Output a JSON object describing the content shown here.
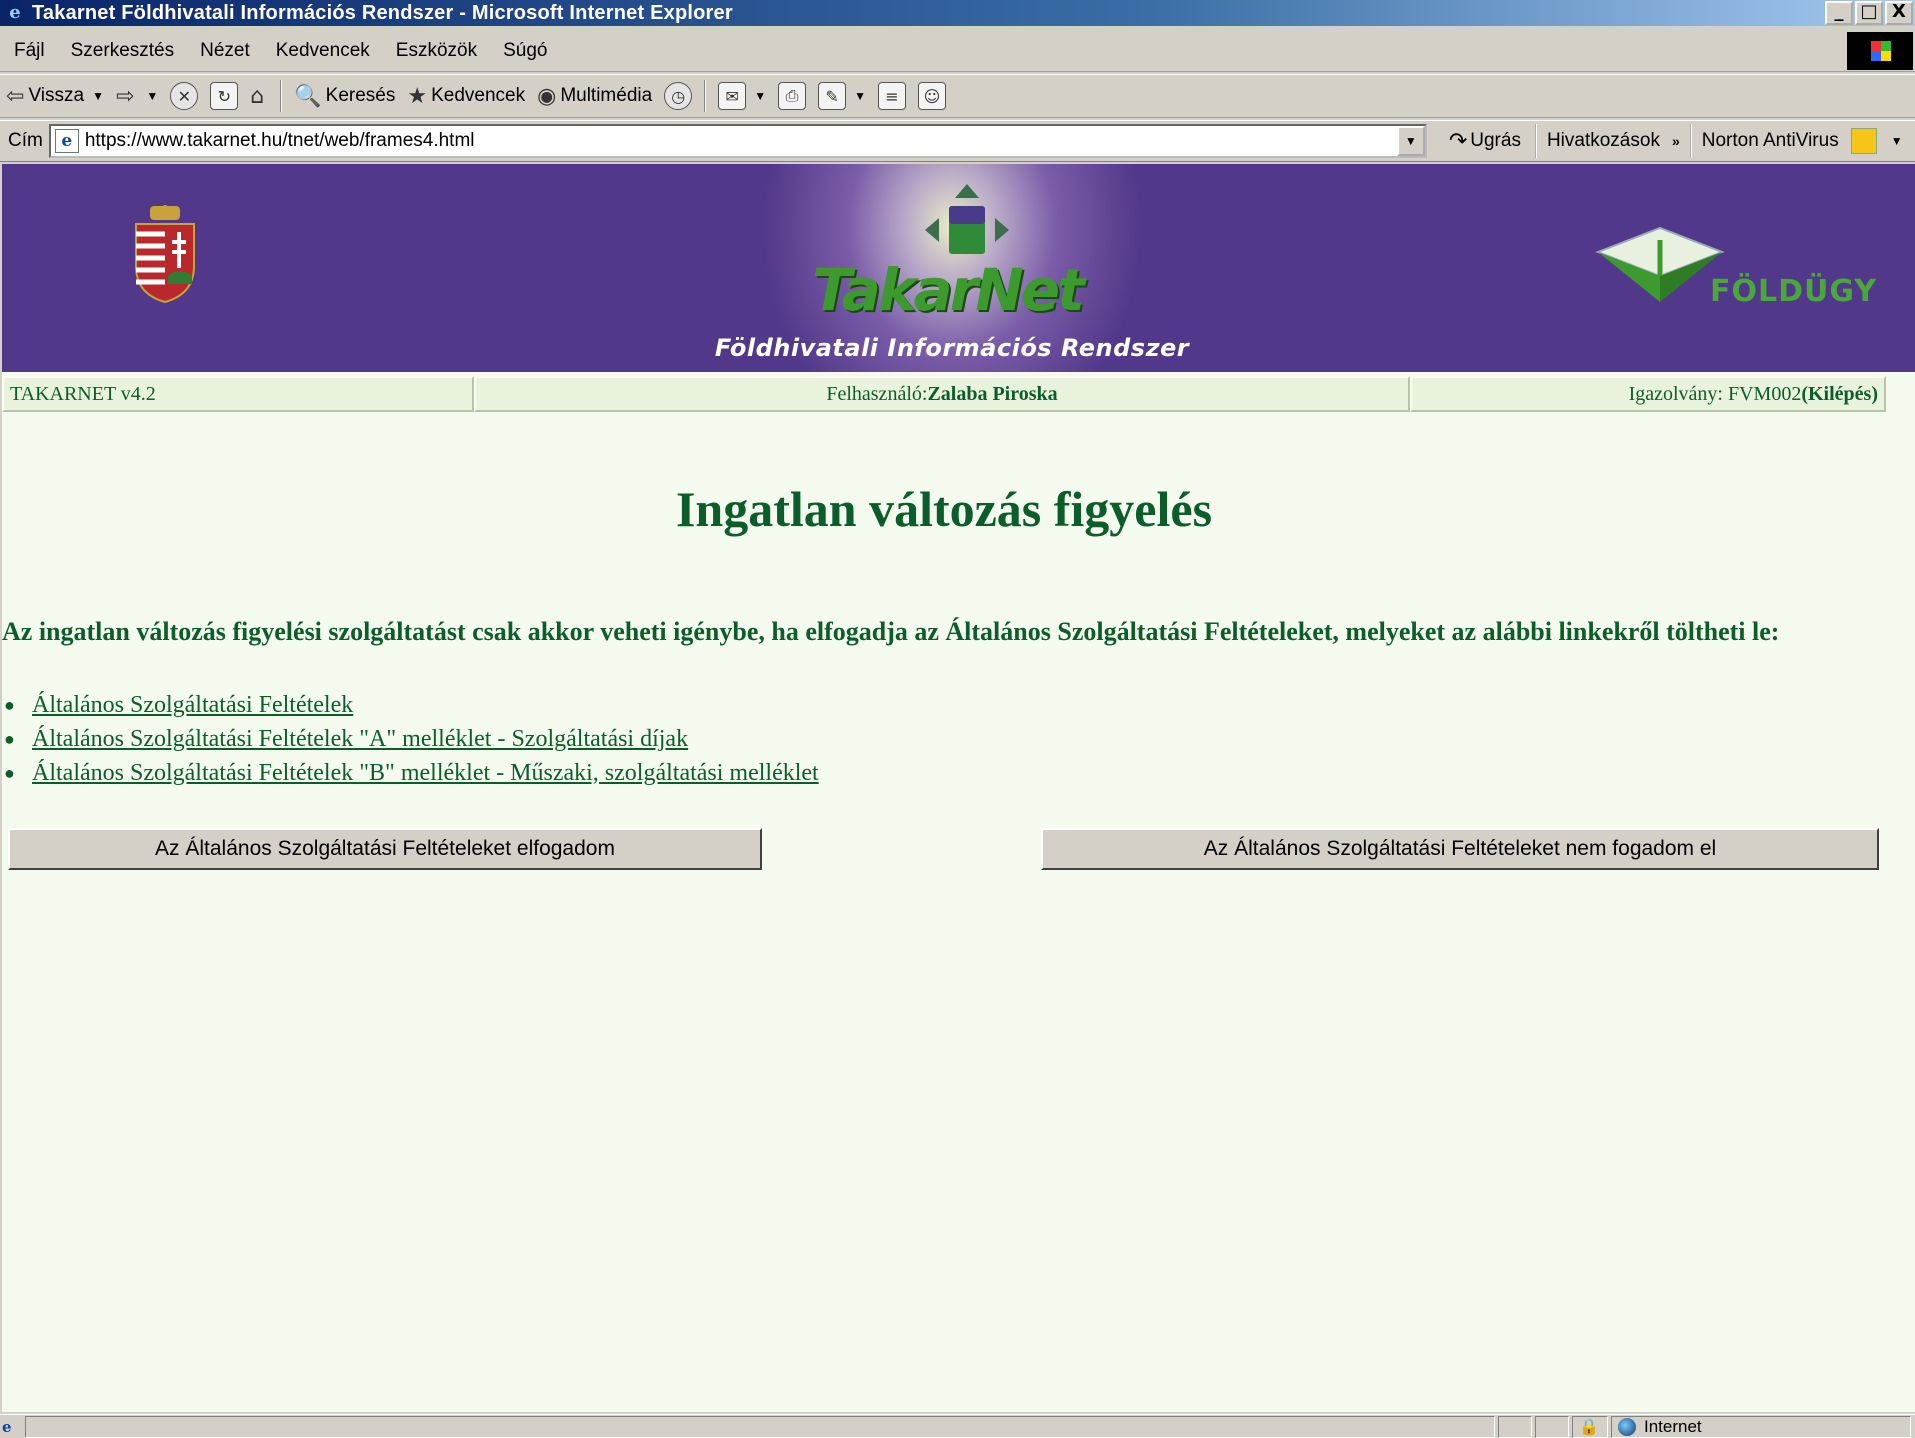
{
  "window": {
    "title": "Takarnet Földhivatali Információs Rendszer - Microsoft Internet Explorer",
    "controls": [
      "_",
      "□",
      "X"
    ]
  },
  "menu": [
    "Fájl",
    "Szerkesztés",
    "Nézet",
    "Kedvencek",
    "Eszközök",
    "Súgó"
  ],
  "toolbar": {
    "back": "Vissza",
    "search": "Keresés",
    "favorites": "Kedvencek",
    "media": "Multimédia"
  },
  "address": {
    "label": "Cím",
    "url": "https://www.takarnet.hu/tnet/web/frames4.html",
    "go": "Ugrás",
    "links": "Hivatkozások",
    "norton": "Norton AntiVirus"
  },
  "banner": {
    "logo_text": "TakarNet",
    "subtitle": "Földhivatali Információs Rendszer",
    "right_logo_text": "FÖLDÜGY",
    "colors": {
      "background": "#52388a",
      "green": "#3c9a2e"
    }
  },
  "info": {
    "version": "TAKARNET v4.2",
    "user_label": "Felhasználó: ",
    "user_name": "Zalaba Piroska",
    "id_label": "Igazolvány: FVM002 ",
    "logout": "(Kilépés)"
  },
  "main": {
    "heading": "Ingatlan változás figyelés",
    "intro": "Az ingatlan változás figyelési szolgáltatást csak akkor veheti igénybe, ha elfogadja az Általános Szolgáltatási Feltételeket, melyeket az alábbi linkekről töltheti le:",
    "links": [
      "Általános Szolgáltatási Feltételek",
      "Általános Szolgáltatási Feltételek \"A\" melléklet - Szolgáltatási díjak",
      "Általános Szolgáltatási Feltételek \"B\" melléklet - Műszaki, szolgáltatási melléklet"
    ],
    "accept_button": "Az Általános Szolgáltatási Feltételeket elfogadom",
    "decline_button": "Az Általános Szolgáltatási Feltételeket nem fogadom el",
    "text_color": "#0b5e2a",
    "page_background": "#f4faee"
  },
  "status": {
    "zone": "Internet"
  }
}
